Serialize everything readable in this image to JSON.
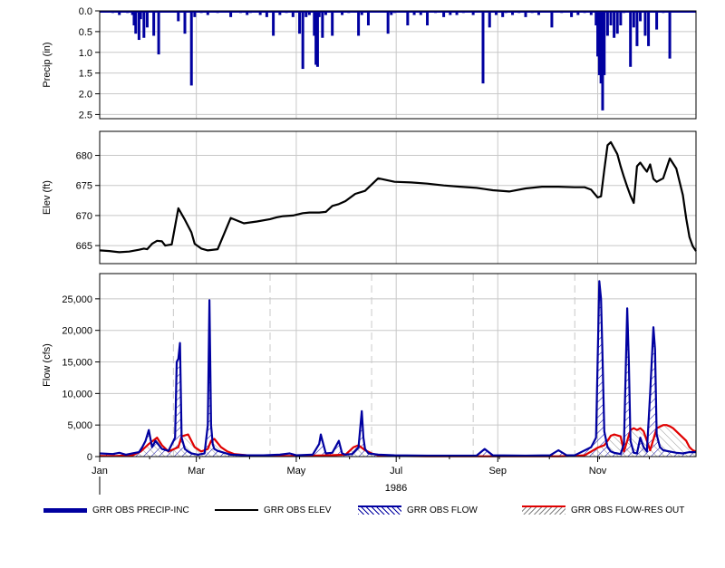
{
  "chart_data": [
    {
      "type": "bar",
      "ylabel": "Precip (in)",
      "ylim": [
        0,
        2.6
      ],
      "y_inverted": true,
      "yticks": [
        "0.0",
        "0.5",
        "1.0",
        "1.5",
        "2.0",
        "2.5"
      ],
      "ytick_values": [
        0,
        0.5,
        1.0,
        1.5,
        2.0,
        2.5
      ],
      "grid": true,
      "series": [
        {
          "name": "GRR OBS PRECIP-INC",
          "color": "#0000a0",
          "x_day": [
            8,
            12,
            17,
            20,
            21,
            22,
            24,
            25,
            27,
            29,
            33,
            36,
            48,
            52,
            56,
            58,
            62,
            66,
            72,
            80,
            86,
            90,
            92,
            98,
            102,
            106,
            110,
            114,
            118,
            122,
            124,
            126,
            128,
            131,
            132,
            133,
            134,
            136,
            138,
            142,
            148,
            152,
            158,
            160,
            164,
            176,
            178,
            180,
            188,
            192,
            196,
            200,
            205,
            210,
            214,
            218,
            222,
            228,
            234,
            238,
            242,
            246,
            248,
            252,
            256,
            260,
            264,
            268,
            276,
            282,
            288,
            292,
            296,
            300,
            303,
            304,
            305,
            306,
            307,
            308,
            310,
            312,
            314,
            316,
            318,
            320,
            324,
            326,
            328,
            330,
            333,
            335,
            340,
            344,
            348
          ],
          "values": [
            0.05,
            0.1,
            0.05,
            0.1,
            0.35,
            0.55,
            0.7,
            0.2,
            0.65,
            0.4,
            0.6,
            1.05,
            0.25,
            0.55,
            1.8,
            0.15,
            0.05,
            0.1,
            0.05,
            0.15,
            0.05,
            0.1,
            0.05,
            0.1,
            0.15,
            0.6,
            0.1,
            0.05,
            0.15,
            0.55,
            1.4,
            0.15,
            0.1,
            0.6,
            1.3,
            1.35,
            0.15,
            0.65,
            0.1,
            0.6,
            0.1,
            0.05,
            0.6,
            0.1,
            0.35,
            0.55,
            0.1,
            0.05,
            0.35,
            0.1,
            0.1,
            0.35,
            0.05,
            0.15,
            0.1,
            0.1,
            0.05,
            0.1,
            1.75,
            0.4,
            0.1,
            0.15,
            0.05,
            0.1,
            0.05,
            0.15,
            0.05,
            0.1,
            0.4,
            0.05,
            0.15,
            0.1,
            0.05,
            0.1,
            0.35,
            1.1,
            1.55,
            1.75,
            2.4,
            1.55,
            0.6,
            0.35,
            0.65,
            0.55,
            0.35,
            0.05,
            1.35,
            0.4,
            0.85,
            0.25,
            0.6,
            0.85,
            0.45,
            0.05,
            1.15
          ]
        }
      ]
    },
    {
      "type": "line",
      "ylabel": "Elev (ft)",
      "ylim": [
        662,
        684
      ],
      "yticks": [
        "665",
        "670",
        "675",
        "680"
      ],
      "ytick_values": [
        665,
        670,
        675,
        680
      ],
      "grid": true,
      "series": [
        {
          "name": "GRR OBS ELEV",
          "color": "#000000",
          "x_day": [
            0,
            6,
            12,
            18,
            24,
            27,
            29,
            32,
            35,
            38,
            40,
            44,
            48,
            52,
            56,
            58,
            62,
            66,
            72,
            80,
            88,
            96,
            104,
            108,
            112,
            118,
            124,
            128,
            134,
            138,
            142,
            146,
            150,
            156,
            162,
            170,
            180,
            190,
            200,
            210,
            220,
            230,
            235,
            240,
            250,
            260,
            270,
            280,
            290,
            296,
            300,
            304,
            306,
            308,
            310,
            312,
            316,
            318,
            320,
            322,
            324,
            326,
            328,
            330,
            332,
            334,
            336,
            338,
            340,
            344,
            348,
            352,
            356,
            358,
            360,
            362,
            364
          ],
          "values": [
            664.2,
            664.1,
            663.9,
            664.0,
            664.3,
            664.5,
            664.4,
            665.3,
            665.8,
            665.7,
            665.0,
            665.2,
            671.2,
            669.3,
            667.2,
            665.3,
            664.5,
            664.2,
            664.4,
            669.6,
            668.7,
            669.0,
            669.4,
            669.7,
            669.9,
            670.0,
            670.4,
            670.5,
            670.5,
            670.6,
            671.6,
            671.9,
            672.4,
            673.6,
            674.1,
            676.2,
            675.6,
            675.5,
            675.3,
            675.0,
            674.8,
            674.6,
            674.4,
            674.2,
            674.0,
            674.5,
            674.8,
            674.8,
            674.7,
            674.7,
            674.3,
            673.0,
            673.2,
            677.6,
            681.7,
            682.2,
            680.2,
            678.2,
            676.4,
            674.8,
            673.3,
            672.1,
            678.2,
            678.8,
            678.0,
            677.3,
            678.5,
            676.1,
            675.6,
            676.2,
            679.5,
            677.8,
            673.4,
            669.5,
            666.4,
            664.9,
            664.1
          ]
        }
      ]
    },
    {
      "type": "line",
      "ylabel": "Flow (cfs)",
      "ylim": [
        0,
        29000
      ],
      "yticks": [
        "0",
        "5,000",
        "10,000",
        "15,000",
        "20,000",
        "25,000"
      ],
      "ytick_values": [
        0,
        5000,
        10000,
        15000,
        20000,
        25000
      ],
      "xticks": [
        "Jan",
        "Mar",
        "May",
        "Jul",
        "Sep",
        "Nov"
      ],
      "xtick_days": [
        0,
        59,
        120,
        181,
        243,
        304
      ],
      "xlabel": "1986",
      "grid": true,
      "series": [
        {
          "name": "GRR OBS FLOW",
          "color": "#0000a0",
          "x_day": [
            0,
            8,
            12,
            16,
            20,
            24,
            26,
            28,
            30,
            32,
            34,
            38,
            42,
            46,
            47,
            48,
            49,
            50,
            52,
            54,
            56,
            60,
            64,
            66,
            67,
            68,
            69,
            70,
            72,
            76,
            80,
            90,
            100,
            110,
            116,
            120,
            130,
            134,
            135,
            136,
            138,
            142,
            146,
            147,
            148,
            150,
            154,
            158,
            160,
            161,
            162,
            164,
            170,
            180,
            200,
            230,
            235,
            240,
            260,
            275,
            280,
            285,
            290,
            300,
            303,
            305,
            306,
            307,
            308,
            310,
            312,
            314,
            316,
            318,
            320,
            322,
            323,
            324,
            326,
            328,
            330,
            332,
            334,
            336,
            338,
            339,
            340,
            342,
            344,
            348,
            352,
            356,
            360,
            364
          ],
          "values": [
            500,
            400,
            600,
            300,
            500,
            700,
            1500,
            2500,
            4200,
            1500,
            2500,
            1200,
            900,
            3000,
            15000,
            15500,
            18000,
            3000,
            1200,
            800,
            500,
            300,
            500,
            5000,
            24800,
            5000,
            2000,
            1200,
            900,
            600,
            300,
            200,
            200,
            300,
            500,
            200,
            300,
            2000,
            3500,
            2500,
            500,
            600,
            2500,
            1500,
            500,
            300,
            400,
            1500,
            7200,
            3000,
            1200,
            500,
            300,
            200,
            150,
            150,
            1200,
            200,
            150,
            200,
            1000,
            200,
            200,
            1500,
            3000,
            27800,
            25000,
            15000,
            4000,
            1500,
            800,
            600,
            500,
            400,
            2000,
            23500,
            15000,
            2500,
            600,
            500,
            3000,
            1500,
            800,
            10000,
            20500,
            17000,
            3500,
            1500,
            1000,
            800,
            600,
            500,
            700,
            700
          ]
        },
        {
          "name": "GRR OBS FLOW-RES OUT",
          "color": "#e00000",
          "x_day": [
            0,
            10,
            20,
            25,
            30,
            35,
            38,
            42,
            48,
            50,
            54,
            58,
            62,
            66,
            68,
            70,
            74,
            78,
            82,
            90,
            100,
            110,
            120,
            130,
            140,
            150,
            155,
            158,
            162,
            166,
            170,
            180,
            200,
            230,
            260,
            280,
            290,
            296,
            300,
            304,
            308,
            310,
            312,
            314,
            318,
            320,
            322,
            324,
            326,
            328,
            330,
            332,
            336,
            340,
            344,
            346,
            348,
            350,
            354,
            358,
            360,
            362,
            364
          ],
          "values": [
            100,
            100,
            200,
            800,
            2000,
            3000,
            1800,
            800,
            1500,
            3200,
            3500,
            1500,
            800,
            1200,
            2500,
            2800,
            1500,
            800,
            400,
            200,
            150,
            100,
            100,
            150,
            200,
            300,
            1500,
            1800,
            1000,
            500,
            200,
            100,
            50,
            50,
            50,
            50,
            100,
            200,
            800,
            1400,
            1800,
            2500,
            3300,
            3500,
            3200,
            800,
            2500,
            4200,
            4500,
            4200,
            4500,
            4000,
            1000,
            4500,
            5000,
            5000,
            4800,
            4500,
            3500,
            2500,
            1500,
            1000,
            800
          ]
        }
      ]
    }
  ],
  "legend": {
    "items": [
      {
        "name": "GRR OBS PRECIP-INC",
        "color": "#0000a0",
        "style": "thick"
      },
      {
        "name": "GRR OBS ELEV",
        "color": "#000000",
        "style": "line"
      },
      {
        "name": "GRR OBS FLOW",
        "color": "#0000a0",
        "style": "hatch"
      },
      {
        "name": "GRR OBS FLOW-RES OUT",
        "color": "#e00000",
        "style": "hatch"
      }
    ]
  }
}
